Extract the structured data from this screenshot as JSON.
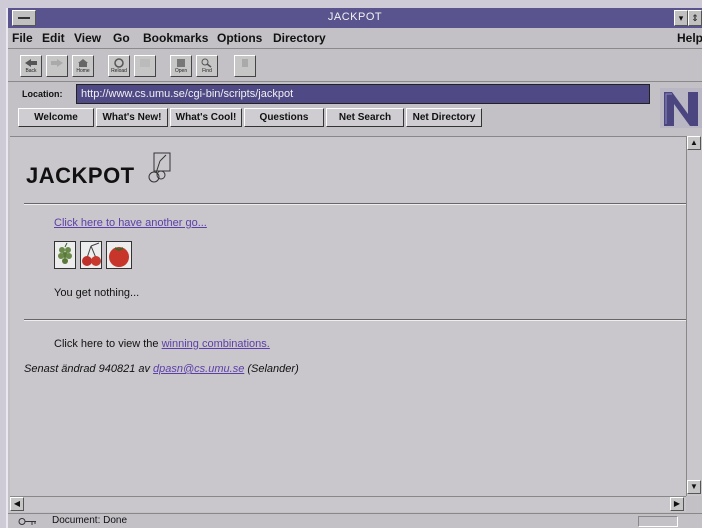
{
  "window": {
    "title": "JACKPOT",
    "help_label": "Help"
  },
  "menus": [
    "File",
    "Edit",
    "View",
    "Go",
    "Bookmarks",
    "Options",
    "Directory"
  ],
  "toolbar": [
    {
      "label": "Back",
      "icon": "back-arrow-icon"
    },
    {
      "label": "",
      "icon": "forward-arrow-icon"
    },
    {
      "label": "Home",
      "icon": "home-icon"
    },
    {
      "label": "Reload",
      "icon": "reload-icon"
    },
    {
      "label": "",
      "icon": "images-icon"
    },
    {
      "label": "Open",
      "icon": "open-icon"
    },
    {
      "label": "Find",
      "icon": "find-icon"
    },
    {
      "label": "",
      "icon": "stop-icon"
    }
  ],
  "location": {
    "label": "Location:",
    "url": "http://www.cs.umu.se/cgi-bin/scripts/jackpot"
  },
  "directory_buttons": [
    "Welcome",
    "What's New!",
    "What's Cool!",
    "Questions",
    "Net Search",
    "Net Directory"
  ],
  "page": {
    "heading": "JACKPOT",
    "again_link": "Click here to have another go...",
    "result": "You get nothing...",
    "view_text": "Click here to view the ",
    "view_link": "winning combinations.",
    "footer_prefix": "Senast ändrad 940821 av ",
    "footer_email": "dpasn@cs.umu.se",
    "footer_suffix": " (Selander)"
  },
  "reels": [
    "grapes",
    "cherries",
    "tomato"
  ],
  "status": {
    "text": "Document: Done"
  },
  "colors": {
    "titlebar": "#59548e",
    "location_bg": "#4f4a86",
    "link": "#5c3fa8",
    "background": "#c9c7cc"
  }
}
